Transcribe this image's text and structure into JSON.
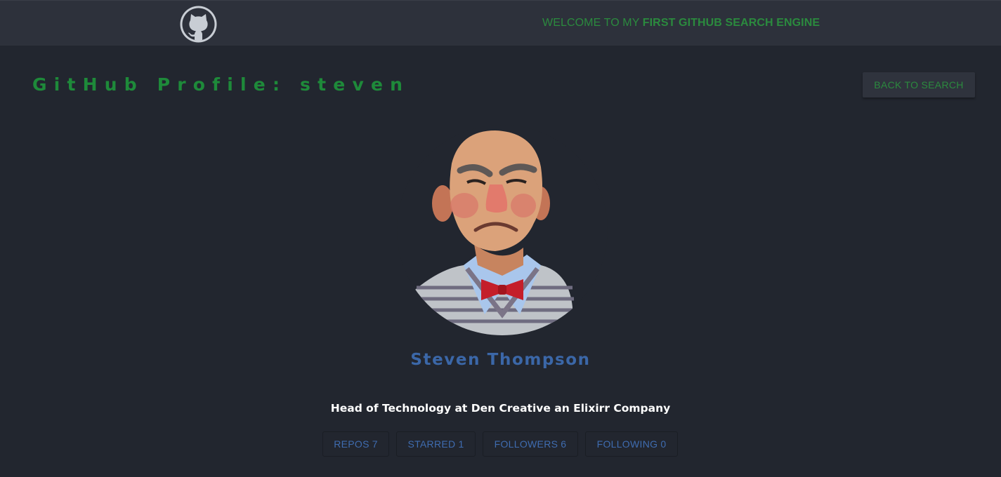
{
  "navbar": {
    "logo": "github-octocat-icon",
    "welcome_prefix": "WELCOME TO MY ",
    "welcome_bold": "FIRST GITHUB SEARCH ENGINE"
  },
  "header": {
    "title": "GitHub Profile: steven",
    "back_button": "BACK TO SEARCH"
  },
  "profile": {
    "avatar": "user-avatar-image",
    "name": "Steven Thompson",
    "bio": "Head of Technology at Den Creative an Elixirr Company"
  },
  "stats": [
    {
      "label": "REPOS",
      "value": "7"
    },
    {
      "label": "STARRED",
      "value": "1"
    },
    {
      "label": "FOLLOWERS",
      "value": "6"
    },
    {
      "label": "FOLLOWING",
      "value": "0"
    }
  ],
  "colors": {
    "background": "#22262f",
    "navbar": "#2d313b",
    "accent_green": "#2b8a3e",
    "accent_blue": "#3f6cb0",
    "text_white": "#ffffff"
  }
}
